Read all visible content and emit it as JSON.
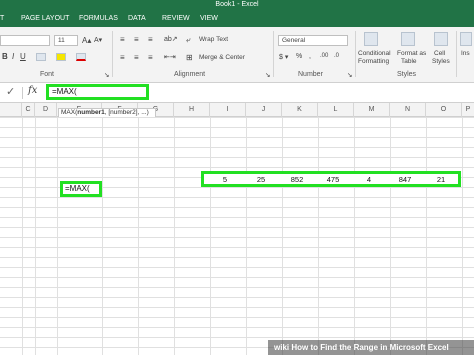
{
  "window": {
    "title": "Book1 - Excel"
  },
  "tabs": [
    "T",
    "PAGE LAYOUT",
    "FORMULAS",
    "DATA",
    "REVIEW",
    "VIEW"
  ],
  "ribbon": {
    "font_size": "11",
    "wrap_text": "Wrap Text",
    "merge_center": "Merge & Center",
    "number_format": "General",
    "conditional_formatting_line1": "Conditional",
    "conditional_formatting_line2": "Formatting",
    "format_as_table_line1": "Format as",
    "format_as_table_line2": "Table",
    "cell_styles_line1": "Cell",
    "cell_styles_line2": "Styles",
    "insert_label": "Ins",
    "groups": {
      "font": "Font",
      "alignment": "Alignment",
      "number": "Number",
      "styles": "Styles"
    }
  },
  "formula_bar": {
    "fx": "fx",
    "check": "✓",
    "value": "=MAX("
  },
  "tooltip": {
    "prefix": "MAX(",
    "bold_arg": "number1",
    "rest": ", [number2], ...)"
  },
  "columns": [
    "C",
    "D",
    "E",
    "F",
    "G",
    "H",
    "I",
    "J",
    "K",
    "L",
    "M",
    "N",
    "O",
    "P"
  ],
  "active_cell": {
    "value": "=MAX("
  },
  "range_values": [
    "5",
    "25",
    "852",
    "475",
    "4",
    "847",
    "21"
  ],
  "banner": {
    "wiki": "wiki",
    "text": "How to Find the Range in Microsoft Excel"
  },
  "colors": {
    "excel_green": "#217346",
    "highlight_green": "#22e022"
  }
}
